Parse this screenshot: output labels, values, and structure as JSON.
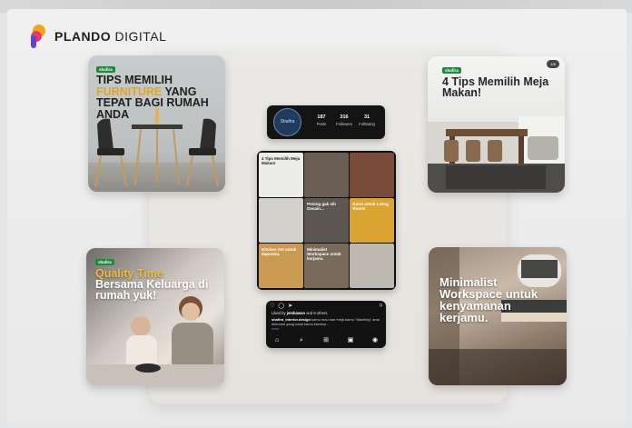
{
  "brand": {
    "name_bold": "PLANDO",
    "name_regular": "DIGITAL"
  },
  "posts": {
    "p1": {
      "tag": "shafira",
      "title_part1": "TIPS MEMILIH",
      "title_highlight": "FURNITURE",
      "title_part2": "YANG TEPAT BAGI RUMAH ANDA"
    },
    "p2": {
      "tag": "shafira",
      "title": "4 Tips Memilih Meja Makan!",
      "badge": "1/8"
    },
    "p3": {
      "tag": "shafira",
      "title_highlight": "Quality Time",
      "title_rest": "Bersama Keluarga di rumah yuk!"
    },
    "p4": {
      "title": "Minimalist Workspace untuk kenyamanan kerjamu."
    }
  },
  "profile": {
    "avatar_text": "Shafira",
    "stats": [
      {
        "value": "187",
        "label": "Posts"
      },
      {
        "value": "316",
        "label": "Followers"
      },
      {
        "value": "31",
        "label": "Following"
      }
    ]
  },
  "grid": {
    "cells": [
      {
        "text": "4 Tips Memilih Meja Makan!",
        "bg": "#ececea",
        "fg": "#222222"
      },
      {
        "text": "",
        "bg": "#6b5f55",
        "fg": "#ffffff"
      },
      {
        "text": "",
        "bg": "#7a4b3a",
        "fg": "#ffffff"
      },
      {
        "text": "",
        "bg": "#d4d1cc",
        "fg": "#222222"
      },
      {
        "text": "Pening gak sih Desain...",
        "bg": "#5c5750",
        "fg": "#ffffff"
      },
      {
        "text": "Kursi untuk Living Room!",
        "bg": "#d9a430",
        "fg": "#ffffff"
      },
      {
        "text": "Kitchen Set untuk dapurmu.",
        "bg": "#c99a52",
        "fg": "#ffffff"
      },
      {
        "text": "Minimalist Workspace untuk kerjamu.",
        "bg": "#7a6a5c",
        "fg": "#ffffff"
      },
      {
        "text": "",
        "bg": "#bdb8b0",
        "fg": "#222222"
      }
    ]
  },
  "caption": {
    "liked_by": "Liked by",
    "liked_user": "jembawan",
    "liked_rest": "and 8 others",
    "account": "shafira_interior.design",
    "text": "kamu mau kan meja kamu \"Maching\" ama dekorasi yang udah kamu konsep...",
    "more": "more"
  },
  "icons": {
    "heart": "♡",
    "comment": "◯",
    "share": "➤",
    "bookmark": "⌑",
    "home": "⌂",
    "search": "⌕",
    "add": "⊞",
    "shop": "▣",
    "profile": "◉"
  }
}
